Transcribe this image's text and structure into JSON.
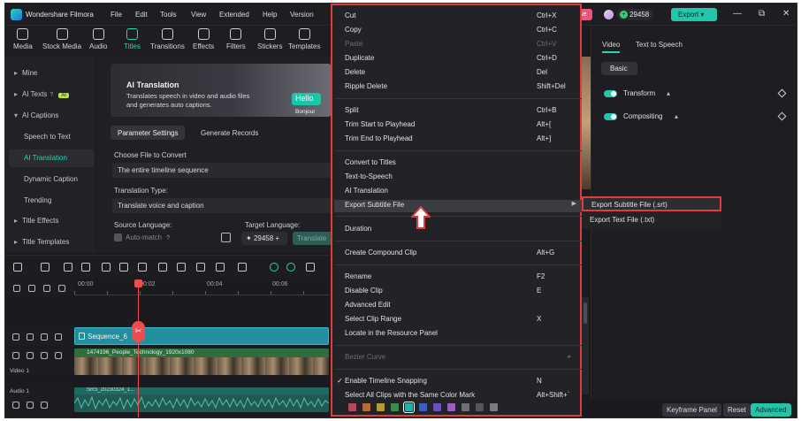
{
  "app": {
    "name": "Wondershare Filmora",
    "menu": [
      "File",
      "Edit",
      "Tools",
      "View",
      "Extended",
      "Help",
      "Version"
    ],
    "promo_label": "ase",
    "credits": "29458",
    "export_label": "Export",
    "window_controls": [
      "—",
      "⧉",
      "✕"
    ]
  },
  "toolbar": {
    "items": [
      {
        "label": "Media",
        "icon": "media-icon"
      },
      {
        "label": "Stock Media",
        "icon": "stock-media-icon"
      },
      {
        "label": "Audio",
        "icon": "audio-icon"
      },
      {
        "label": "Titles",
        "icon": "titles-icon",
        "active": true
      },
      {
        "label": "Transitions",
        "icon": "transitions-icon"
      },
      {
        "label": "Effects",
        "icon": "effects-icon"
      },
      {
        "label": "Filters",
        "icon": "filters-icon"
      },
      {
        "label": "Stickers",
        "icon": "stickers-icon"
      },
      {
        "label": "Templates",
        "icon": "templates-icon"
      }
    ]
  },
  "sidebar": {
    "items": [
      {
        "label": "Mine",
        "arrow": "▸"
      },
      {
        "label": "AI Texts",
        "arrow": "▸",
        "badge": "AI"
      },
      {
        "label": "AI Captions",
        "arrow": "▾"
      },
      {
        "label": "Speech to Text"
      },
      {
        "label": "AI Translation",
        "selected": true
      },
      {
        "label": "Dynamic Caption"
      },
      {
        "label": "Trending"
      },
      {
        "label": "Title Effects",
        "arrow": "▸"
      },
      {
        "label": "Title Templates",
        "arrow": "▸"
      }
    ]
  },
  "ai_translation": {
    "title": "AI Translation",
    "description": "Translates speech in video and audio files and generates auto captions.",
    "hello_text": "Hello",
    "bonjour_text": "Bonjour",
    "tabs": [
      "Parameter Settings",
      "Generate Records"
    ],
    "choose_label": "Choose File to Convert",
    "choose_value": "The entire timeline sequence",
    "translation_type_label": "Translation Type:",
    "translation_type_value": "Translate voice and caption",
    "source_language_label": "Source Language:",
    "target_language_label": "Target Language:",
    "auto_match_label": "Auto-match",
    "credits_value": "29458",
    "translate_label": "Translate"
  },
  "context_menu": {
    "items": [
      {
        "label": "Cut",
        "shortcut": "Ctrl+X"
      },
      {
        "label": "Copy",
        "shortcut": "Ctrl+C"
      },
      {
        "label": "Paste",
        "shortcut": "Ctrl+V",
        "disabled": true
      },
      {
        "label": "Duplicate",
        "shortcut": "Ctrl+D"
      },
      {
        "label": "Delete",
        "shortcut": "Del"
      },
      {
        "label": "Ripple Delete",
        "shortcut": "Shift+Del"
      },
      {
        "label": "Split",
        "shortcut": "Ctrl+B"
      },
      {
        "label": "Trim Start to Playhead",
        "shortcut": "Alt+["
      },
      {
        "label": "Trim End to Playhead",
        "shortcut": "Alt+]"
      },
      {
        "label": "Convert to Titles",
        "shortcut": ""
      },
      {
        "label": "Text-to-Speech",
        "shortcut": ""
      },
      {
        "label": "AI Translation",
        "shortcut": ""
      },
      {
        "label": "Export Subtitle File",
        "shortcut": "",
        "submenu": true
      },
      {
        "label": "Duration",
        "shortcut": ""
      },
      {
        "label": "Create Compound Clip",
        "shortcut": "Alt+G"
      },
      {
        "label": "Rename",
        "shortcut": "F2"
      },
      {
        "label": "Disable Clip",
        "shortcut": "E"
      },
      {
        "label": "Advanced Edit",
        "shortcut": ""
      },
      {
        "label": "Select Clip Range",
        "shortcut": "X"
      },
      {
        "label": "Locate in the Resource Panel",
        "shortcut": ""
      },
      {
        "label": "Bezier Curve",
        "shortcut": "",
        "disabled": true,
        "submenu": true
      },
      {
        "label": "Enable Timeline Snapping",
        "shortcut": "N",
        "checked": true
      },
      {
        "label": "Select All Clips with the Same Color Mark",
        "shortcut": "Alt+Shift+`"
      }
    ],
    "swatch_colors": [
      "#b24a58",
      "#b56a3a",
      "#b59a3a",
      "#3e8a4c",
      "#1fb3a6",
      "#3f5fc0",
      "#6a4fbf",
      "#9a5fb8",
      "#6e6e74",
      "#55555c",
      "#7a7a82"
    ],
    "selected_swatch": 4
  },
  "submenu": {
    "items": [
      "Export Subtitle File (.srt)",
      "Export Text File (.txt)"
    ]
  },
  "right_panel": {
    "tabs": [
      "Video",
      "Text to Speech"
    ],
    "basic_label": "Basic",
    "props": [
      "Transform",
      "Compositing"
    ],
    "footer": {
      "keyframe": "Keyframe Panel",
      "reset": "Reset",
      "advanced": "Advanced"
    }
  },
  "timeline": {
    "ruler": [
      "00:00",
      "00:02",
      "00:04",
      "00:06"
    ],
    "tracks": {
      "video": "Video 1",
      "audio": "Audio 1"
    },
    "sequence_name": "Sequence_6",
    "video_clip": "1474196_People_Technology_1920x1080",
    "audio_clip": "SRS_20230324_1..."
  }
}
